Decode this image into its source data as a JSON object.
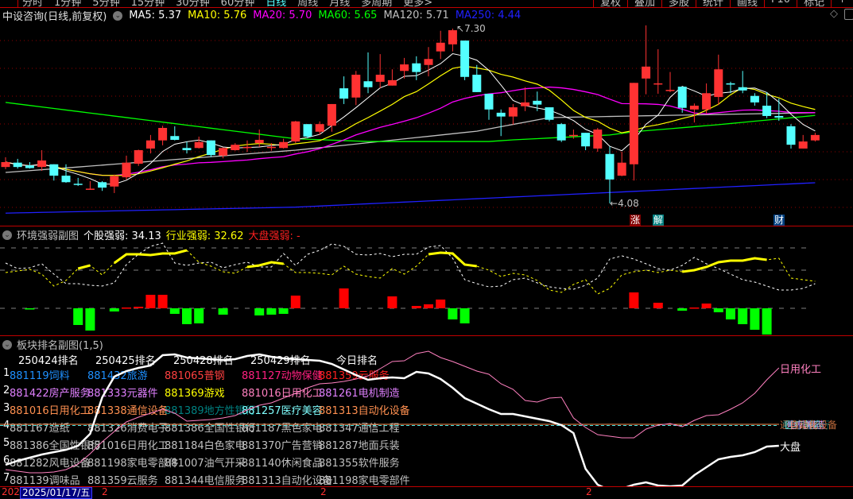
{
  "toolbar": {
    "periods": [
      "分时",
      "1分钟",
      "5分钟",
      "15分钟",
      "30分钟",
      "60分钟",
      "日线",
      "周线",
      "月线",
      "多周期",
      "更多>"
    ],
    "active_period": "日线",
    "tools": [
      "复权",
      "叠加",
      "多股",
      "统计",
      "画线",
      "F10",
      "标记",
      "+"
    ]
  },
  "main": {
    "title": "中设咨询(日线,前复权)",
    "ma": [
      {
        "label": "MA5: 5.37",
        "color": "#ffffff"
      },
      {
        "label": "MA10: 5.76",
        "color": "#ffff00"
      },
      {
        "label": "MA20: 5.70",
        "color": "#ff00ff"
      },
      {
        "label": "MA60: 5.65",
        "color": "#00ff00"
      },
      {
        "label": "MA120: 5.71",
        "color": "#c0c0c0"
      },
      {
        "label": "MA250: 4.44",
        "color": "#2020ff"
      }
    ],
    "high_label": "7.30",
    "low_label": "4.08",
    "markers": [
      {
        "text": "涨",
        "bg": "#800000"
      },
      {
        "text": "解",
        "bg": "#008080"
      },
      {
        "text": "财",
        "bg": "#004080"
      }
    ]
  },
  "panel2": {
    "title": "环境强弱副图",
    "stock": "个股强弱: 34.13",
    "industry": "行业强弱: 32.62",
    "market": "大盘强弱: -"
  },
  "panel3": {
    "title": "板块排名副图(1,5)",
    "headers": [
      "250424排名",
      "250425排名",
      "250428排名",
      "250429排名",
      "今日排名"
    ],
    "rows": [
      {
        "rank": "1",
        "cells": [
          {
            "t": "881119饲料",
            "c": "#1e90ff"
          },
          {
            "t": "881432旅游",
            "c": "#1e90ff"
          },
          {
            "t": "881065普钢",
            "c": "#ff4040"
          },
          {
            "t": "881127动物保健",
            "c": "#ff2080"
          },
          {
            "t": "881359云服务",
            "c": "#ff2020"
          }
        ]
      },
      {
        "rank": "2",
        "cells": [
          {
            "t": "881422房产服务",
            "c": "#e080ff"
          },
          {
            "t": "881333元器件",
            "c": "#e080ff"
          },
          {
            "t": "881369游戏",
            "c": "#ffff00"
          },
          {
            "t": "881016日用化工",
            "c": "#ff80c0"
          },
          {
            "t": "881261电机制造",
            "c": "#e080ff"
          }
        ]
      },
      {
        "rank": "3",
        "cells": [
          {
            "t": "881016日用化工",
            "c": "#ff9050"
          },
          {
            "t": "881338通信设备",
            "c": "#ff9050"
          },
          {
            "t": "881389地方性银行",
            "c": "#008080"
          },
          {
            "t": "881257医疗美容",
            "c": "#80ffff"
          },
          {
            "t": "881313自动化设备",
            "c": "#ff9050"
          }
        ]
      },
      {
        "rank": "4",
        "cells": [
          {
            "t": "881167造纸",
            "c": "#c0c0c0"
          },
          {
            "t": "881326消费电子",
            "c": "#c0c0c0"
          },
          {
            "t": "881386全国性银行",
            "c": "#c0c0c0"
          },
          {
            "t": "881187黑色家电",
            "c": "#c0c0c0"
          },
          {
            "t": "881347通信工程",
            "c": "#c0c0c0"
          }
        ]
      },
      {
        "rank": "5",
        "cells": [
          {
            "t": "881386全国性银行",
            "c": "#c0c0c0"
          },
          {
            "t": "881016日用化工",
            "c": "#c0c0c0"
          },
          {
            "t": "881184白色家电",
            "c": "#c0c0c0"
          },
          {
            "t": "881370广告营销",
            "c": "#c0c0c0"
          },
          {
            "t": "881287地面兵装",
            "c": "#c0c0c0"
          }
        ]
      },
      {
        "rank": "6",
        "cells": [
          {
            "t": "881282风电设备",
            "c": "#c0c0c0"
          },
          {
            "t": "881198家电零部件",
            "c": "#c0c0c0"
          },
          {
            "t": "881007油气开采",
            "c": "#c0c0c0"
          },
          {
            "t": "881140休闲食品",
            "c": "#c0c0c0"
          },
          {
            "t": "881355软件服务",
            "c": "#c0c0c0"
          }
        ]
      },
      {
        "rank": "7",
        "cells": [
          {
            "t": "881139调味品",
            "c": "#c0c0c0"
          },
          {
            "t": "881359云服务",
            "c": "#c0c0c0"
          },
          {
            "t": "881344电信服务",
            "c": "#c0c0c0"
          },
          {
            "t": "881313自动化设备",
            "c": "#c0c0c0"
          },
          {
            "t": "881198家电零部件",
            "c": "#c0c0c0"
          }
        ]
      }
    ],
    "line_labels": {
      "industry": "日用化工",
      "market": "大盘"
    },
    "overlap_labels": [
      {
        "t": "通信设备",
        "c": "#ff9050"
      },
      {
        "t": "地方性银行",
        "c": "#008080"
      },
      {
        "t": "医疗美容",
        "c": "#80ffff"
      },
      {
        "t": "电机制造",
        "c": "#e080ff"
      },
      {
        "t": "自动化设备",
        "c": "#ff9050"
      }
    ]
  },
  "axis": {
    "date": "2025/01/17/五",
    "left_cut": "202",
    "tick": "2"
  },
  "chart_data": {
    "type": "candlestick",
    "price_range": [
      4.08,
      7.3
    ],
    "candles": [
      [
        4.75,
        4.93,
        4.71,
        4.84
      ],
      [
        4.83,
        4.9,
        4.72,
        4.75
      ],
      [
        4.78,
        4.84,
        4.72,
        4.73
      ],
      [
        4.75,
        5.06,
        4.68,
        4.87
      ],
      [
        4.8,
        4.8,
        4.5,
        4.59
      ],
      [
        4.59,
        4.8,
        4.46,
        4.47
      ],
      [
        4.43,
        4.55,
        4.4,
        4.41
      ],
      [
        4.34,
        4.49,
        4.33,
        4.34
      ],
      [
        4.47,
        4.49,
        4.31,
        4.37
      ],
      [
        4.39,
        4.61,
        4.27,
        4.58
      ],
      [
        4.56,
        4.96,
        4.52,
        4.83
      ],
      [
        4.81,
        5.07,
        4.77,
        5.06
      ],
      [
        5.09,
        5.34,
        5.0,
        5.24
      ],
      [
        5.24,
        5.51,
        5.15,
        5.47
      ],
      [
        5.32,
        5.5,
        5.24,
        5.25
      ],
      [
        5.1,
        5.22,
        5.0,
        5.06
      ],
      [
        5.1,
        5.31,
        5.09,
        5.21
      ],
      [
        5.24,
        5.24,
        4.93,
        4.97
      ],
      [
        4.96,
        5.11,
        4.91,
        5.1
      ],
      [
        5.06,
        5.19,
        5.05,
        5.16
      ],
      [
        5.1,
        5.24,
        5.03,
        5.11
      ],
      [
        5.19,
        5.44,
        5.12,
        5.25
      ],
      [
        5.1,
        5.19,
        5.05,
        5.11
      ],
      [
        5.1,
        5.27,
        5.09,
        5.21
      ],
      [
        5.22,
        5.6,
        5.19,
        5.59
      ],
      [
        5.54,
        5.54,
        5.28,
        5.31
      ],
      [
        5.4,
        5.59,
        5.34,
        5.54
      ],
      [
        5.51,
        5.91,
        5.4,
        5.91
      ],
      [
        6.2,
        6.42,
        5.91,
        6.01
      ],
      [
        6.03,
        6.52,
        5.89,
        6.45
      ],
      [
        6.33,
        6.86,
        6.11,
        6.22
      ],
      [
        6.32,
        6.83,
        6.2,
        6.45
      ],
      [
        6.25,
        6.55,
        6.25,
        6.35
      ],
      [
        6.52,
        6.76,
        6.38,
        6.64
      ],
      [
        6.66,
        6.79,
        6.35,
        6.5
      ],
      [
        6.63,
        6.96,
        6.42,
        6.74
      ],
      [
        6.88,
        7.26,
        6.74,
        7.04
      ],
      [
        7.01,
        7.3,
        6.88,
        7.27
      ],
      [
        7.08,
        7.08,
        6.35,
        6.41
      ],
      [
        6.45,
        6.63,
        6.13,
        6.13
      ],
      [
        6.1,
        6.1,
        5.62,
        5.81
      ],
      [
        5.75,
        5.81,
        5.32,
        5.68
      ],
      [
        5.68,
        5.91,
        5.53,
        5.85
      ],
      [
        5.87,
        6.22,
        5.78,
        5.94
      ],
      [
        5.97,
        6.14,
        5.78,
        5.9
      ],
      [
        5.85,
        5.85,
        5.59,
        5.62
      ],
      [
        5.54,
        5.56,
        5.21,
        5.24
      ],
      [
        5.32,
        5.44,
        5.27,
        5.33
      ],
      [
        5.38,
        5.38,
        5.06,
        5.13
      ],
      [
        5.09,
        5.47,
        5.03,
        5.44
      ],
      [
        4.99,
        5.13,
        4.08,
        4.52
      ],
      [
        4.59,
        5.03,
        4.58,
        4.83
      ],
      [
        4.8,
        6.3,
        4.5,
        6.3
      ],
      [
        6.38,
        7.36,
        6.09,
        6.6
      ],
      [
        6.27,
        6.92,
        6.1,
        6.28
      ],
      [
        6.15,
        6.5,
        6.13,
        6.16
      ],
      [
        6.23,
        6.23,
        5.75,
        5.84
      ],
      [
        5.81,
        5.92,
        5.57,
        5.88
      ],
      [
        5.81,
        6.29,
        5.73,
        6.11
      ],
      [
        6.04,
        6.82,
        5.89,
        6.55
      ],
      [
        6.28,
        6.32,
        6.11,
        6.27
      ],
      [
        6.22,
        6.52,
        6.11,
        6.16
      ],
      [
        6.06,
        6.11,
        5.88,
        5.94
      ],
      [
        5.88,
        6.13,
        5.65,
        5.69
      ],
      [
        5.69,
        6.01,
        5.6,
        5.66
      ],
      [
        5.5,
        5.54,
        5.09,
        5.16
      ],
      [
        5.09,
        5.34,
        5.09,
        5.22
      ],
      [
        5.24,
        5.38,
        5.22,
        5.34
      ]
    ],
    "ma_anchors": {
      "MA60": [
        [
          0,
          5.94
        ],
        [
          24,
          5.27
        ],
        [
          30,
          5.22
        ],
        [
          40,
          5.22
        ],
        [
          42,
          5.25
        ],
        [
          50,
          5.34
        ],
        [
          52,
          5.4
        ],
        [
          59,
          5.53
        ],
        [
          67,
          5.7
        ]
      ],
      "MA120": [
        [
          0,
          4.65
        ],
        [
          6,
          4.75
        ],
        [
          13,
          4.87
        ],
        [
          24,
          5.06
        ],
        [
          28,
          5.15
        ],
        [
          39,
          5.41
        ],
        [
          45,
          5.66
        ],
        [
          52,
          5.69
        ],
        [
          67,
          5.75
        ]
      ],
      "MA250": [
        [
          0,
          3.9
        ],
        [
          24,
          4.01
        ],
        [
          50,
          4.28
        ],
        [
          67,
          4.46
        ]
      ]
    },
    "strength": {
      "grid": [
        0,
        48,
        76
      ],
      "stock": [
        57,
        50,
        51,
        56,
        43,
        31,
        31,
        29,
        28,
        32,
        55,
        68,
        78,
        82,
        57,
        54,
        57,
        58,
        51,
        55,
        58,
        52,
        52,
        69,
        54,
        68,
        73,
        81,
        78,
        68,
        67,
        69,
        65,
        68,
        68,
        77,
        79,
        63,
        36,
        31,
        27,
        28,
        36,
        38,
        32,
        27,
        25,
        24,
        29,
        38,
        62,
        66,
        62,
        56,
        50,
        48,
        54,
        64,
        56,
        50,
        43,
        36,
        33,
        28,
        23,
        23,
        25,
        31
      ],
      "industry": [
        45,
        47,
        49,
        43,
        28,
        35,
        50,
        54,
        42,
        57,
        68,
        68,
        67,
        69,
        69,
        73,
        58,
        53,
        46,
        44,
        52,
        54,
        58,
        56,
        45,
        45,
        44,
        42,
        53,
        43,
        40,
        38,
        50,
        43,
        53,
        68,
        70,
        69,
        55,
        53,
        48,
        40,
        44,
        42,
        35,
        23,
        20,
        30,
        36,
        18,
        25,
        42,
        46,
        48,
        45,
        48,
        46,
        48,
        52,
        58,
        60,
        60,
        63,
        61,
        63,
        38,
        36,
        34
      ],
      "industry_strong_ranges": [
        [
          6,
          7
        ],
        [
          9,
          15
        ],
        [
          20,
          23
        ],
        [
          35,
          39
        ],
        [
          56,
          63
        ]
      ],
      "bars": [
        0,
        0,
        -1,
        0,
        0,
        0,
        -21,
        -28,
        0,
        -4,
        1,
        2,
        17,
        17,
        -7,
        -20,
        -19,
        0,
        -8,
        0,
        0,
        -9,
        -8,
        -7,
        16,
        0,
        0,
        0,
        25,
        0,
        0,
        0,
        15,
        0,
        3,
        5,
        11,
        -14,
        -19,
        0,
        0,
        0,
        0,
        0,
        0,
        0,
        0,
        0,
        0,
        0,
        0,
        0,
        20,
        0,
        7,
        0,
        -3,
        1,
        6,
        -5,
        -14,
        -20,
        -27,
        -33,
        0,
        0,
        0,
        0
      ]
    },
    "ranking": {
      "reference_level": 91,
      "industry": [
        34,
        32,
        30,
        30,
        31,
        34,
        41,
        54,
        69,
        82,
        94,
        100,
        105,
        110,
        105,
        95,
        96,
        97,
        99,
        102,
        109,
        115,
        118,
        124,
        130,
        137,
        142,
        143,
        145,
        148,
        152,
        161,
        170,
        171,
        180,
        183,
        175,
        170,
        164,
        158,
        154,
        142,
        135,
        121,
        119,
        124,
        125,
        99,
        87,
        78,
        76,
        74,
        74,
        85,
        90,
        92,
        88,
        96,
        102,
        103,
        110,
        118,
        130,
        147,
        162
      ],
      "market": [
        40,
        45,
        49,
        53,
        56,
        59,
        64,
        79,
        125,
        151,
        158,
        162,
        165,
        178,
        179,
        175,
        174,
        173,
        172,
        173,
        177,
        179,
        176,
        174,
        173,
        172,
        171,
        167,
        160,
        153,
        147,
        149,
        150,
        149,
        157,
        155,
        148,
        137,
        124,
        117,
        110,
        104,
        104,
        101,
        98,
        95,
        90,
        80,
        35,
        15,
        8,
        10,
        15,
        18,
        14,
        13,
        14,
        27,
        37,
        47,
        50,
        52,
        56,
        63,
        64
      ]
    }
  }
}
